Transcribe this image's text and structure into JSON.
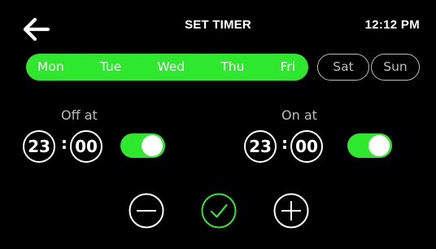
{
  "header": {
    "title": "SET TIMER",
    "clock": "12:12 PM",
    "back_icon": "arrow-left-icon"
  },
  "days": {
    "selected": [
      "Mon",
      "Tue",
      "Wed",
      "Thu",
      "Fri"
    ],
    "unselected": [
      "Sat",
      "Sun"
    ],
    "accent_color": "#2ee82e",
    "unselected_color": "#bdbdbd"
  },
  "off_timer": {
    "label": "Off at",
    "hours": "23",
    "separator": ":",
    "minutes": "00",
    "enabled": true
  },
  "on_timer": {
    "label": "On at",
    "hours": "23",
    "separator": ":",
    "minutes": "00",
    "enabled": true
  },
  "actions": {
    "decrease_icon": "minus-circle-icon",
    "confirm_icon": "check-circle-icon",
    "increase_icon": "plus-circle-icon",
    "confirm_color": "#2ee82e"
  }
}
